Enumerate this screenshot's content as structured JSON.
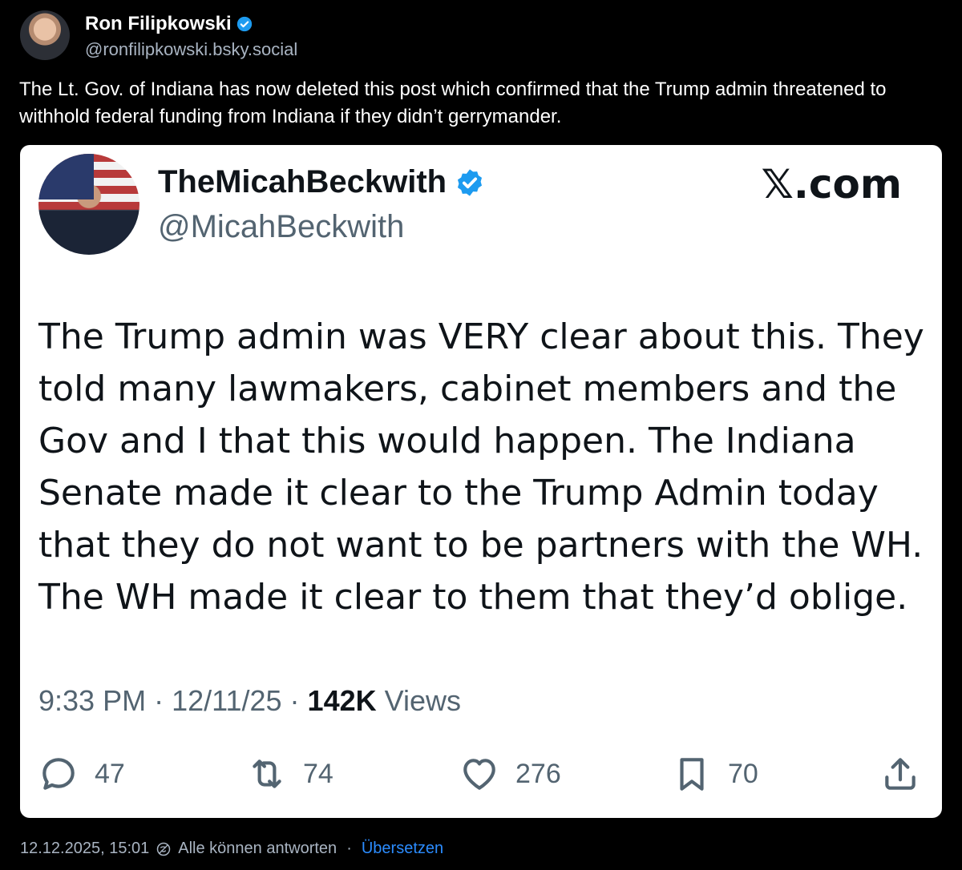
{
  "post": {
    "author_name": "Ron Filipkowski",
    "author_handle": "@ronfilipkowski.bsky.social",
    "text": "The Lt. Gov. of Indiana has now deleted this post which confirmed that the Trump admin threatened to withhold federal funding from Indiana if they didn’t gerrymander.",
    "footer": {
      "timestamp": "12.12.2025, 15:01",
      "reply_setting": "Alle können antworten",
      "separator": "·",
      "translate_link": "Übersetzen"
    }
  },
  "embedded_tweet": {
    "display_name": "TheMicahBeckwith",
    "handle": "@MicahBeckwith",
    "brand": "𝕏.com",
    "body": "The Trump admin was VERY clear about this. They told many lawmakers, cabinet members and the Gov and I that this would happen. The Indiana Senate made it clear to the Trump Admin today that they do not want to be partners with the WH. The WH made it clear to them that they’d oblige.",
    "meta": {
      "time": "9:33 PM",
      "sep1": " · ",
      "date": "12/11/25",
      "sep2": " · ",
      "views_count": "142K",
      "views_label": " Views"
    },
    "actions": {
      "replies": "47",
      "reposts": "74",
      "likes": "276",
      "bookmarks": "70"
    }
  },
  "colors": {
    "background": "#000000",
    "verified": "#1d9bf0",
    "link": "#2b8cff",
    "muted": "#a9b4c2"
  }
}
